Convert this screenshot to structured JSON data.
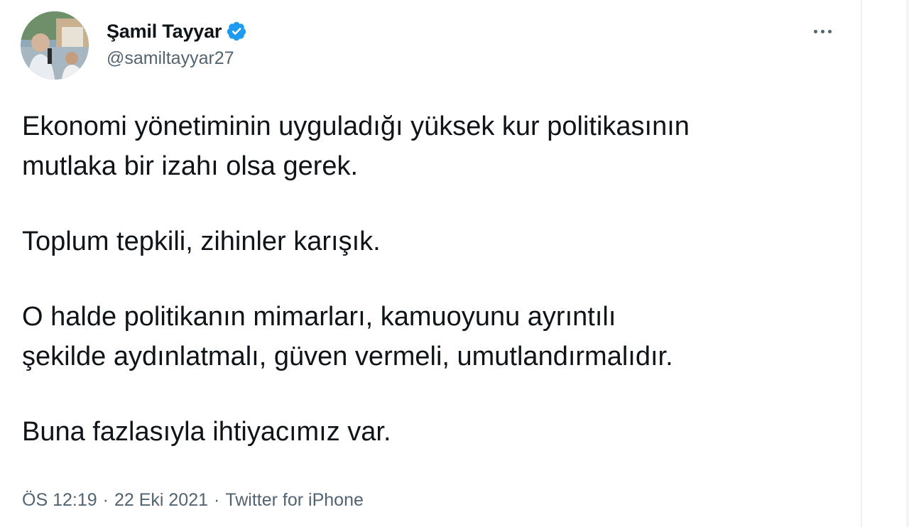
{
  "user": {
    "display_name": "Şamil Tayyar",
    "handle": "@samiltayyar27",
    "verified_icon": "verified-badge-icon",
    "verified_color": "#1d9bf0"
  },
  "tweet": {
    "paragraphs": [
      [
        "Ekonomi yönetiminin uyguladığı yüksek kur politikasının",
        "mutlaka bir izahı olsa gerek."
      ],
      [
        "Toplum tepkili, zihinler karışık."
      ],
      [
        "O halde politikanın mimarları, kamuoyunu ayrıntılı",
        "şekilde aydınlatmalı, güven vermeli, umutlandırmalıdır."
      ],
      [
        "Buna fazlasıyla ihtiyacımız var."
      ]
    ]
  },
  "meta": {
    "time": "ÖS 12:19",
    "date": "22 Eki 2021",
    "source": "Twitter for iPhone",
    "separator": "·"
  },
  "menu": {
    "icon": "more-horizontal-icon"
  },
  "colors": {
    "text": "#0f1419",
    "secondary": "#536471",
    "accent": "#1d9bf0"
  }
}
